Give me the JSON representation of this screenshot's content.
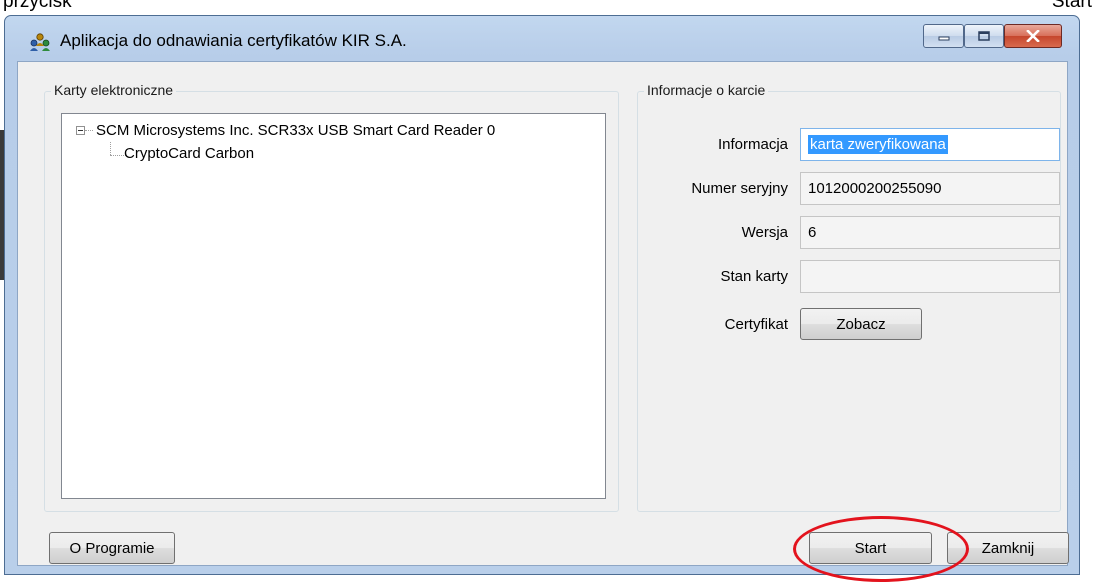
{
  "background": {
    "left_text": "przycisk",
    "right_text": "Start"
  },
  "window": {
    "title": "Aplikacja do odnawiania certyfikatów KIR S.A.",
    "icon": "app-people-icon",
    "controls": {
      "minimize_icon": "minimize-icon",
      "maximize_icon": "maximize-icon",
      "close_icon": "close-icon"
    }
  },
  "cards_group": {
    "label": "Karty elektroniczne",
    "tree": [
      {
        "label": "SCM Microsystems Inc. SCR33x USB Smart Card Reader 0",
        "expanded": true,
        "children": [
          {
            "label": "CryptoCard Carbon"
          }
        ]
      }
    ]
  },
  "card_info": {
    "label": "Informacje o karcie",
    "info_label": "Informacja",
    "info_value": "karta zweryfikowana",
    "serial_label": "Numer seryjny",
    "serial_value": "1012000200255090",
    "version_label": "Wersja",
    "version_value": "6",
    "state_label": "Stan karty",
    "state_value": "",
    "certificate_label": "Certyfikat",
    "certificate_button": "Zobacz"
  },
  "footer": {
    "about_button": "O Programie",
    "start_button": "Start",
    "close_button": "Zamknij"
  },
  "colors": {
    "annotation": "#e3131d",
    "selection": "#3399ff"
  }
}
